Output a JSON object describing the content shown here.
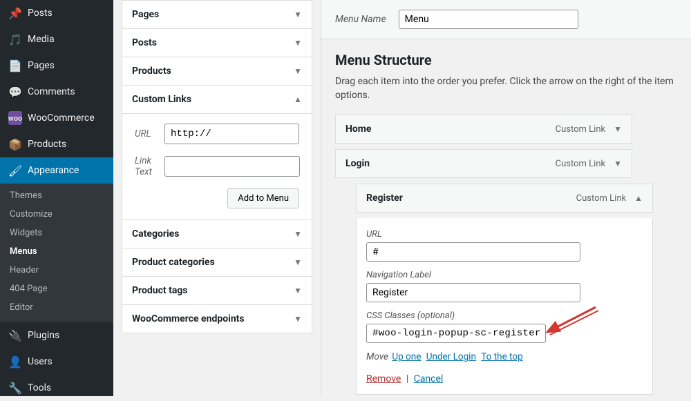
{
  "sidebar": {
    "items": [
      {
        "label": "Posts",
        "icon": "📌"
      },
      {
        "label": "Media",
        "icon": "🖼"
      },
      {
        "label": "Pages",
        "icon": "📄"
      },
      {
        "label": "Comments",
        "icon": "💬"
      },
      {
        "label": "WooCommerce",
        "icon": "W"
      },
      {
        "label": "Products",
        "icon": "📦"
      },
      {
        "label": "Appearance",
        "icon": "🖌",
        "current": true
      },
      {
        "label": "Plugins",
        "icon": "🔌"
      },
      {
        "label": "Users",
        "icon": "👤"
      },
      {
        "label": "Tools",
        "icon": "🔧"
      }
    ],
    "appearance_sub": [
      "Themes",
      "Customize",
      "Widgets",
      "Menus",
      "Header",
      "404 Page",
      "Editor"
    ],
    "appearance_active": "Menus"
  },
  "accord": {
    "pages": "Pages",
    "posts": "Posts",
    "products": "Products",
    "custom_links": "Custom Links",
    "custom_links_url_label": "URL",
    "custom_links_url_value": "http://",
    "custom_links_text_label": "Link Text",
    "custom_links_text_value": "",
    "add_to_menu": "Add to Menu",
    "categories": "Categories",
    "product_categories": "Product categories",
    "product_tags": "Product tags",
    "woo_endpoints": "WooCommerce endpoints"
  },
  "menu": {
    "name_label": "Menu Name",
    "name_value": "Menu",
    "structure_title": "Menu Structure",
    "structure_desc": "Drag each item into the order you prefer. Click the arrow on the right of the item options.",
    "items": [
      {
        "title": "Home",
        "type": "Custom Link",
        "depth": 0
      },
      {
        "title": "Login",
        "type": "Custom Link",
        "depth": 0
      },
      {
        "title": "Register",
        "type": "Custom Link",
        "depth": 1,
        "open": true,
        "url_label": "URL",
        "url_value": "#",
        "navlabel_label": "Navigation Label",
        "navlabel_value": "Register",
        "css_label": "CSS Classes (optional)",
        "css_value": "#woo-login-popup-sc-register",
        "move_label": "Move",
        "move_up": "Up one",
        "move_under": "Under Login",
        "move_top": "To the top",
        "remove": "Remove",
        "cancel": "Cancel"
      }
    ]
  }
}
